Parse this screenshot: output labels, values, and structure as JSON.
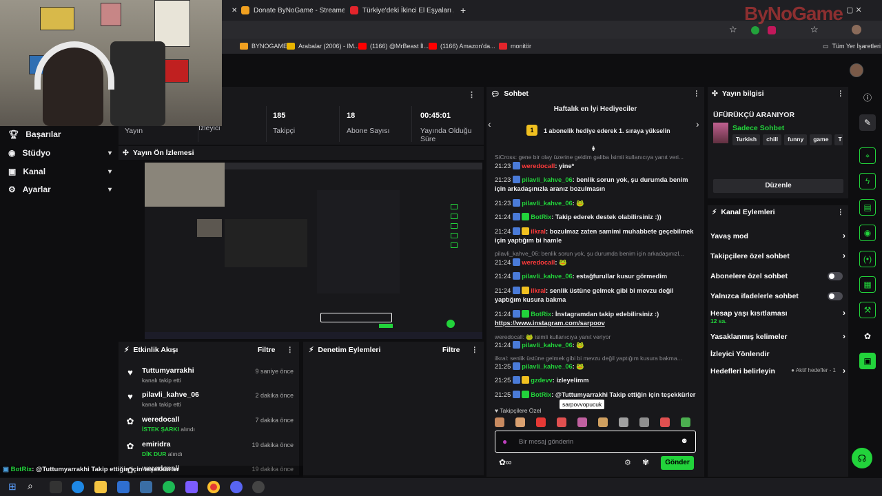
{
  "browser": {
    "tabs": [
      {
        "title": "Donate ByNoGame - Streamer",
        "color": "#f0a020"
      },
      {
        "title": "Türkiye'deki İkinci El Eşyaları Al",
        "color": "#e3242b"
      }
    ],
    "new_tab": "+",
    "bookmarks": [
      {
        "label": "BYNOGAME",
        "color": "#f0a020"
      },
      {
        "label": "Arabalar (2006) - IM...",
        "color": "#e8b400"
      },
      {
        "label": "(1166) @MrBeast İl...",
        "color": "#ff0000"
      },
      {
        "label": "(1166) Amazon'da...",
        "color": "#ff0000"
      },
      {
        "label": "monitör",
        "color": "#e3242b"
      }
    ],
    "all_bookmarks": "Tüm Yer İşaretleri"
  },
  "watermark": "ByNoGame",
  "sidebar": {
    "items": [
      {
        "label": "Başarılar",
        "icon": "trophy-icon"
      },
      {
        "label": "Stüdyo",
        "icon": "studio-icon"
      },
      {
        "label": "Kanal",
        "icon": "channel-icon"
      },
      {
        "label": "Ayarlar",
        "icon": "gear-icon"
      }
    ]
  },
  "stats": [
    {
      "value": "",
      "label": "Yayın"
    },
    {
      "value": "",
      "label": "İzleyici"
    },
    {
      "value": "185",
      "label": "Takipçi"
    },
    {
      "value": "18",
      "label": "Abone Sayısı"
    },
    {
      "value": "00:45:01",
      "label": "Yayında Olduğu Süre"
    }
  ],
  "preview": {
    "title": "Yayın Ön İzlemesi"
  },
  "activity": {
    "title": "Etkinlik Akışı",
    "filter": "Filtre",
    "items": [
      {
        "name": "Tuttumyarrakhi",
        "sub": "kanalı takip etti",
        "time": "9 saniye önce",
        "icon": "heart-icon",
        "green": false
      },
      {
        "name": "pilavli_kahve_06",
        "sub": "kanalı takip etti",
        "time": "2 dakika önce",
        "icon": "heart-icon",
        "green": false
      },
      {
        "name": "weredocall",
        "sub": "İSTEK ŞARKI",
        "sub2": "alındı",
        "time": "7 dakika önce",
        "icon": "points-icon",
        "green": true
      },
      {
        "name": "emiridra",
        "sub": "DİK DUR",
        "sub2": "alındı",
        "time": "19 dakika önce",
        "icon": "points-icon",
        "green": true
      },
      {
        "name": "weredocall",
        "sub": "",
        "time": "19 dakika önce",
        "icon": "points-icon",
        "green": false
      }
    ]
  },
  "moderation": {
    "title": "Denetim Eylemleri",
    "filter": "Filtre"
  },
  "chat": {
    "title": "Sohbet",
    "gifters_title": "Haftalık en İyi Hediyeciler",
    "gifters_rank": "1",
    "gifters_text": "1 abonelik hediye ederek 1. sıraya yükselin",
    "messages": [
      {
        "sys": true,
        "text": "SiCross: gene bir olay üzerine geldim galiba İsimli kullanıcıya yanıt veri..."
      },
      {
        "time": "21:23",
        "user": "weredocall",
        "color": "#ff3b3b",
        "text": ": yine*",
        "b1": "#4a7bd8"
      },
      {
        "time": "21:23",
        "user": "pilavli_kahve_06",
        "color": "#22d33b",
        "text": ": benlik sorun yok, şu durumda benim için arkadaşınızla aranız bozulmasın",
        "b1": "#4a7bd8"
      },
      {
        "time": "21:23",
        "user": "pilavli_kahve_06",
        "color": "#22d33b",
        "text": ": 🐸",
        "b1": "#4a7bd8"
      },
      {
        "time": "21:24",
        "user": "BotRix",
        "color": "#22d33b",
        "text": ": Takip ederek destek olabilirsiniz :))",
        "b1": "#4a7bd8",
        "b2": "#22d33b"
      },
      {
        "time": "21:24",
        "user": "ilkral",
        "color": "#ff3b3b",
        "text": ": bozulmaz zaten samimi muhabbete geçebilmek için yaptığım bi hamle",
        "b1": "#4a7bd8",
        "b2": "#f0c020"
      },
      {
        "sys": true,
        "text": "pilavli_kahve_06: benlik sorun yok, şu durumda benim için arkadaşınızl..."
      },
      {
        "time": "21:24",
        "user": "weredocall",
        "color": "#ff3b3b",
        "text": ": 🐸",
        "b1": "#4a7bd8"
      },
      {
        "time": "21:24",
        "user": "pilavli_kahve_06",
        "color": "#22d33b",
        "text": ": estağfurullar kusur görmedim",
        "b1": "#4a7bd8"
      },
      {
        "time": "21:24",
        "user": "ilkral",
        "color": "#ff3b3b",
        "text": ": senlik üstüne gelmek gibi bi mevzu değil yaptığım kusura bakma",
        "b1": "#4a7bd8",
        "b2": "#f0c020"
      },
      {
        "time": "21:24",
        "user": "BotRix",
        "color": "#22d33b",
        "text": ": İnstagramdan takip edebilirsiniz :)",
        "link": "https://www.instagram.com/sarpoov",
        "b1": "#4a7bd8",
        "b2": "#22d33b"
      },
      {
        "sys": true,
        "text": "weredocall: 🐸 isimli kullanıcıya yanıt veriyor"
      },
      {
        "time": "21:24",
        "user": "pilavli_kahve_06",
        "color": "#22d33b",
        "text": ": 🐸",
        "b1": "#4a7bd8"
      },
      {
        "sys": true,
        "text": "ilkral: senlik üstüne gelmek gibi bi mevzu değil yaptığım kusura bakma..."
      },
      {
        "time": "21:25",
        "user": "pilavli_kahve_06",
        "color": "#22d33b",
        "text": ": 🐸",
        "b1": "#4a7bd8"
      },
      {
        "time": "21:25",
        "user": "gzdevv",
        "color": "#22d33b",
        "text": ": izleyelimm",
        "b1": "#4a7bd8",
        "b2": "#f0c020"
      },
      {
        "time": "21:25",
        "user": "BotRix",
        "color": "#22d33b",
        "text": ": @Tuttumyarrakhi Takip ettiğin için teşekkürler",
        "b1": "#4a7bd8",
        "b2": "#22d33b"
      }
    ],
    "follower_only_label": "Takipçilere Özel",
    "tooltip": "sarpovvopucuk",
    "placeholder": "Bir mesaj gönderin",
    "send": "Gönder"
  },
  "stream_info": {
    "title": "Yayın bilgisi",
    "stream_title": "ÜFÜRÜKÇÜ ARANIYOR",
    "category": "Sadece Sohbet",
    "tags": [
      "Turkish",
      "chill",
      "funny",
      "game",
      "T"
    ],
    "edit": "Düzenle"
  },
  "channel_actions": {
    "title": "Kanal Eylemleri",
    "rows": [
      {
        "label": "Yavaş mod",
        "type": "chevron"
      },
      {
        "label": "Takipçilere özel sohbet",
        "type": "chevron"
      },
      {
        "label": "Abonelere özel sohbet",
        "type": "toggle"
      },
      {
        "label": "Yalnızca ifadelerle sohbet",
        "type": "toggle"
      },
      {
        "label": "Hesap yaşı kısıtlaması",
        "sub": "12 sa.",
        "type": "chevron"
      },
      {
        "label": "Yasaklanmış kelimeler",
        "type": "chevron"
      },
      {
        "label": "İzleyici Yönlendir",
        "type": "none"
      },
      {
        "label": "Hedefleri belirleyin",
        "right": "Aktif hedefler - 1",
        "type": "chevron"
      }
    ]
  },
  "ticker": {
    "user": "BotRix",
    "text": ": @Tuttumyarrakhi Takip ettiğin için teşekkürler"
  },
  "colors": {
    "accent": "#22d33b",
    "bg": "#0e0e10",
    "panel": "#18181b"
  }
}
